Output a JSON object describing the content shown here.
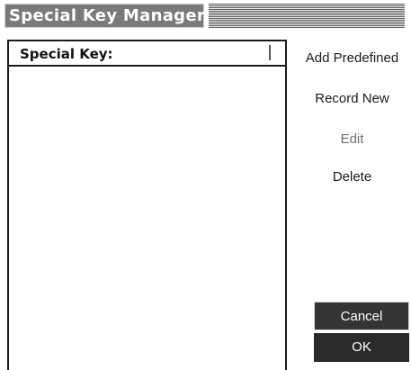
{
  "window": {
    "title": "Special Key Manager"
  },
  "list": {
    "header": "Special Key:",
    "items": []
  },
  "actions": {
    "add_predefined": "Add Predefined",
    "record_new": "Record New",
    "edit": "Edit",
    "delete": "Delete"
  },
  "buttons": {
    "cancel": "Cancel",
    "ok": "OK"
  },
  "colors": {
    "title_bar_bg": "#7a7a7a",
    "button_bg": "#2e2e2e",
    "button_text": "#ffffff",
    "disabled_text": "#6f6f6f"
  }
}
